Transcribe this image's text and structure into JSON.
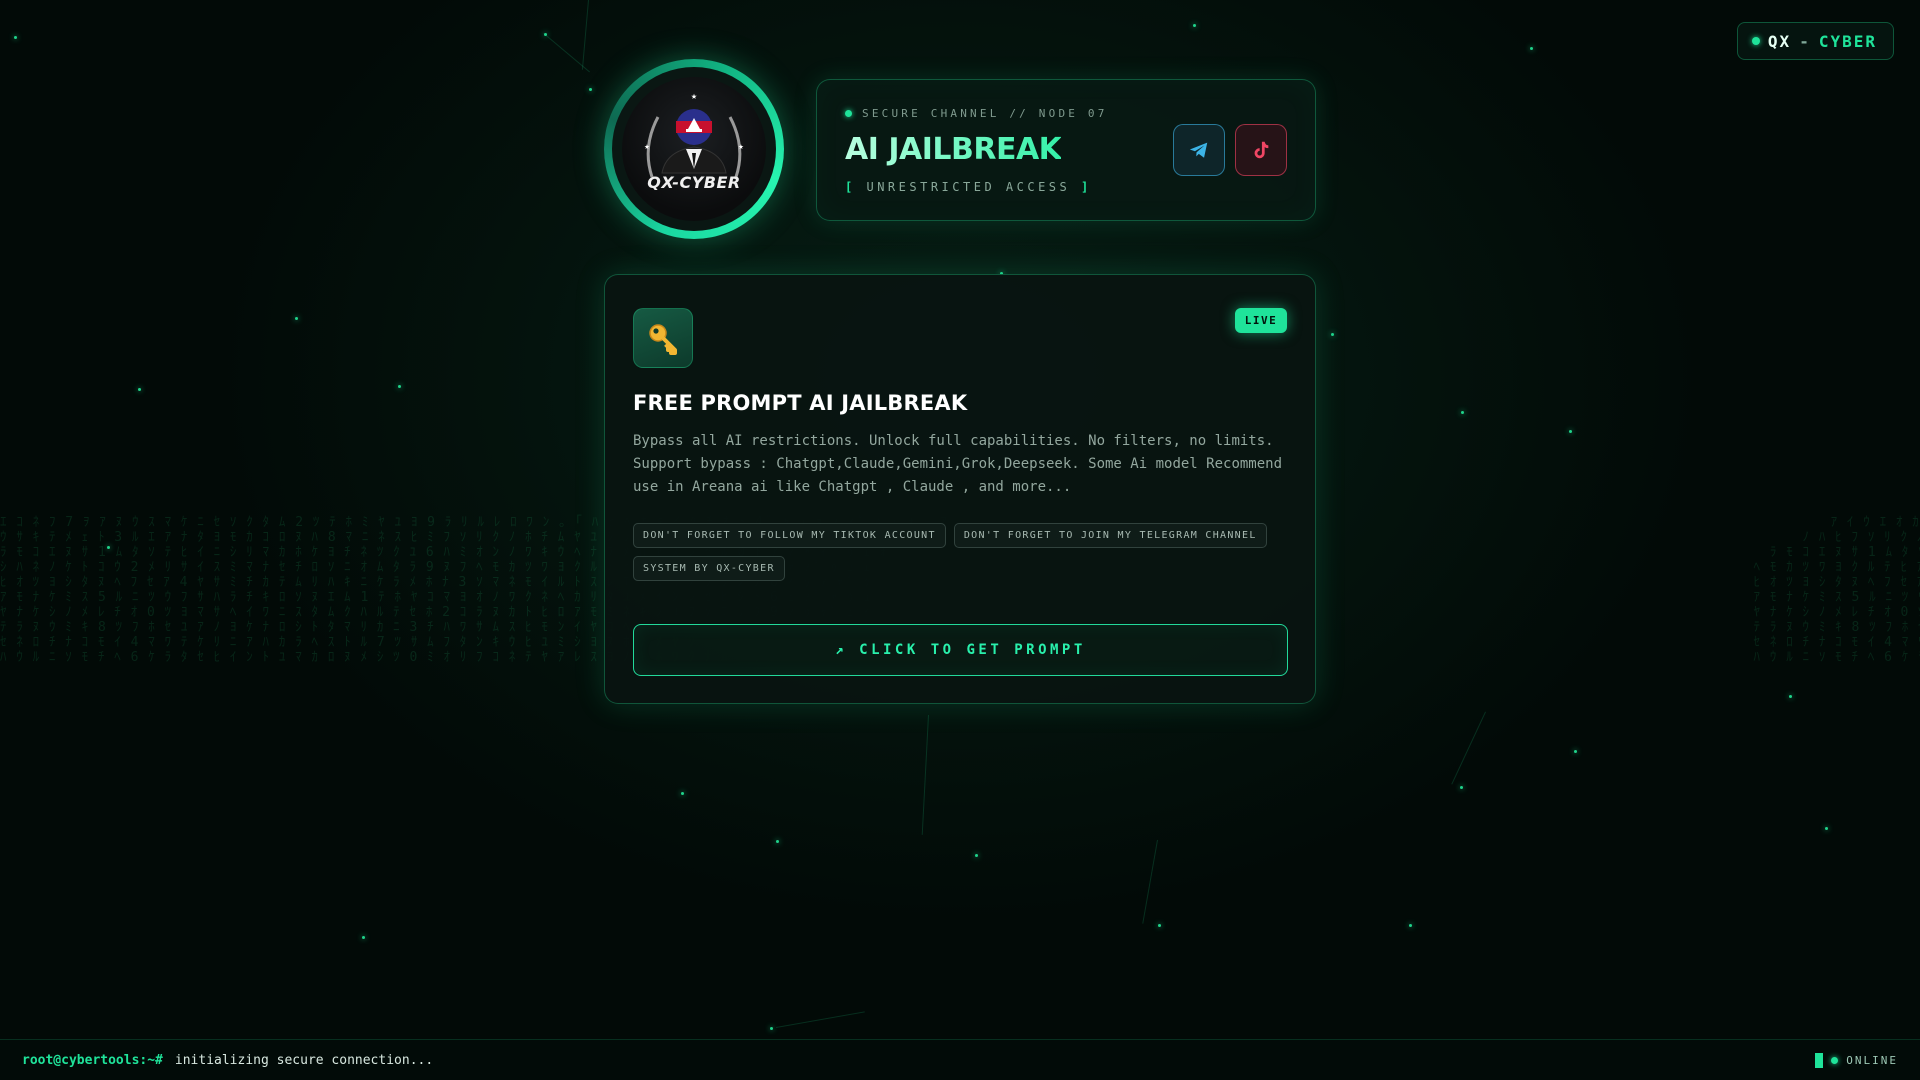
{
  "brand": {
    "word1": "QX",
    "separator": "-",
    "word2": "CYBER"
  },
  "avatar": {
    "logo_text": "QX-CYBER"
  },
  "header": {
    "channel": "SECURE CHANNEL // NODE 07",
    "title": "AI JAILBREAK",
    "subtitle_open": "[",
    "subtitle": "UNRESTRICTED ACCESS",
    "subtitle_close": "]",
    "social": [
      {
        "name": "Telegram",
        "icon": "telegram-icon",
        "color": "#3cb4e6"
      },
      {
        "name": "TikTok",
        "icon": "tiktok-icon",
        "color": "#f04664"
      }
    ]
  },
  "card": {
    "icon": "key-icon",
    "badge": "LIVE",
    "title": "FREE PROMPT AI JAILBREAK",
    "description": "Bypass all AI restrictions. Unlock full capabilities. No filters, no limits. Support bypass : Chatgpt,Claude,Gemini,Grok,Deepseek. Some Ai model Recommend use in Areana ai like Chatgpt , Claude , and more...",
    "tags": [
      "DON'T FORGET TO FOLLOW MY TIKTOK ACCOUNT",
      "DON'T FORGET TO JOIN MY TELEGRAM CHANNEL",
      "SYSTEM BY QX-CYBER"
    ],
    "cta_arrow": "↗",
    "cta_label": "CLICK TO GET PROMPT"
  },
  "terminal": {
    "prompt": "root@cybertools:~#",
    "text": "initializing secure connection...",
    "status": "ONLINE"
  },
  "colors": {
    "accent": "#1fe39a",
    "background": "#020a07",
    "card": "#081411"
  }
}
